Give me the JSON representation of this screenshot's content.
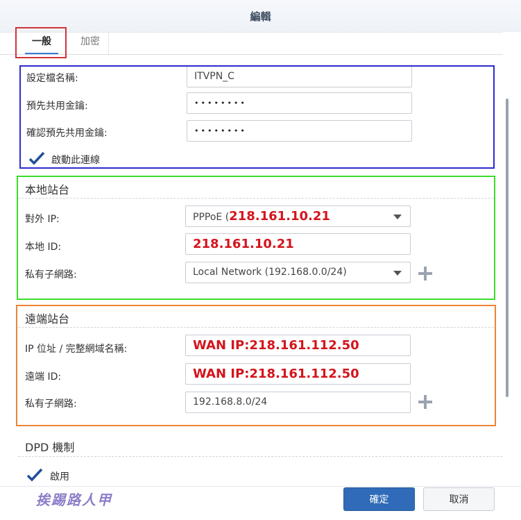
{
  "window": {
    "title": "編輯"
  },
  "tabs": [
    {
      "label": "一般"
    },
    {
      "label": "加密"
    }
  ],
  "general": {
    "profile_name_label": "設定檔名稱:",
    "profile_name_value": "ITVPN_C",
    "psk_label": "預先共用金鑰:",
    "psk_value": "••••••••",
    "psk_confirm_label": "確認預先共用金鑰:",
    "psk_confirm_value": "••••••••",
    "enable_label": "啟動此連線",
    "enable_checked": true
  },
  "local_site": {
    "title": "本地站台",
    "external_ip_label": "對外 IP:",
    "external_ip_prefix": "PPPoE (",
    "external_ip_value": "218.161.10.21",
    "local_id_label": "本地 ID:",
    "local_id_value": "218.161.10.21",
    "subnet_label": "私有子網路:",
    "subnet_value": "Local Network (192.168.0.0/24)"
  },
  "remote_site": {
    "title": "遠端站台",
    "address_label": "IP 位址 / 完整網域名稱:",
    "address_value": "WAN IP:218.161.112.50",
    "remote_id_label": "遠端 ID:",
    "remote_id_value": "WAN IP:218.161.112.50",
    "subnet_label": "私有子網路:",
    "subnet_value": "192.168.8.0/24"
  },
  "dpd": {
    "title": "DPD 機制",
    "enable_label": "啟用"
  },
  "footer": {
    "ok_label": "確定",
    "cancel_label": "取消",
    "watermark": "挨踢路人甲"
  },
  "colors": {
    "primary_button": "#2f6bb8",
    "annotation_red": "#d4141c",
    "highlight_blue": "#2d2bd0",
    "highlight_green": "#3ddc2a",
    "highlight_orange": "#ee8432",
    "highlight_tab": "#d0333a"
  }
}
